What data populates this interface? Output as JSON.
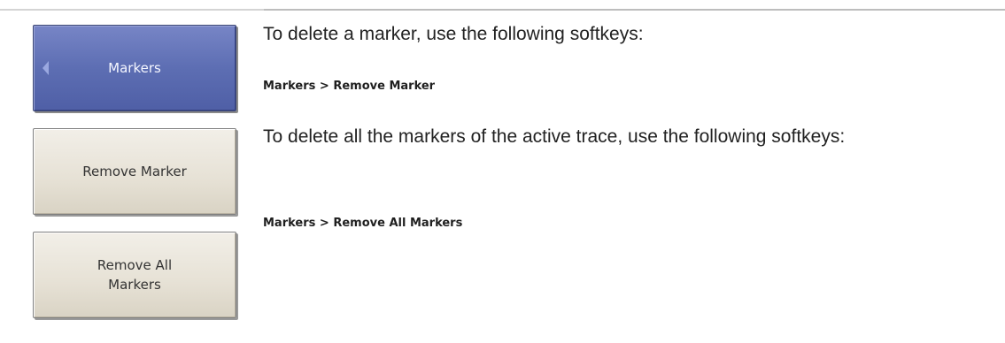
{
  "softkeys": [
    {
      "label": "Markers",
      "style": "menu",
      "has_back_arrow": true
    },
    {
      "label": "Remove Marker",
      "style": "normal",
      "has_back_arrow": false
    },
    {
      "label": "Remove All Markers",
      "style": "normal",
      "has_back_arrow": false
    }
  ],
  "text": {
    "para1": "To delete a marker, use the following softkeys:",
    "path1": "Markers > Remove Marker",
    "para2": "To delete all the markers of the active trace, use the following softkeys:",
    "path2": "Markers > Remove All Markers"
  },
  "colors": {
    "menu_key": "#5d6eb3",
    "normal_key": "#e6e1d5",
    "rule": "#bdbdbd"
  },
  "icons": {
    "back_arrow": "left-triangle"
  }
}
